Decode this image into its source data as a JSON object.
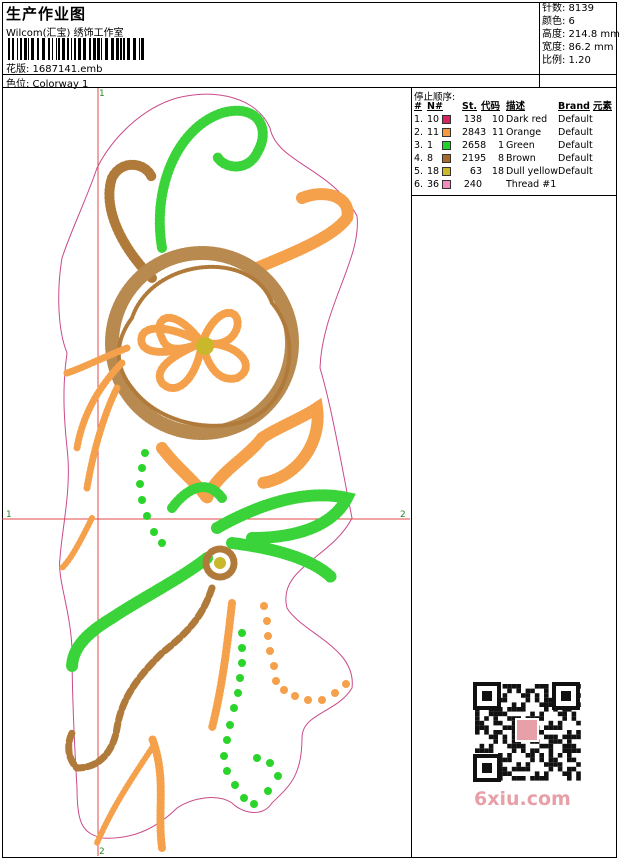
{
  "header": {
    "title": "生产作业图",
    "company": "Wilcom(汇宝) 绣饰工作室",
    "design_label": "花版: 1687141.emb",
    "colorway_label": "色位: Colorway 1"
  },
  "stats": {
    "stitches": "针数: 8139",
    "colors": "颜色: 6",
    "height": "高度: 214.8 mm",
    "width": "宽度: 86.2 mm",
    "scale": "比例: 1.20"
  },
  "sequence": {
    "heading": "停止顺序:",
    "columns": {
      "idx": "#",
      "n": "N#",
      "st": "St.",
      "code": "代码",
      "desc": "描述",
      "brand": "Brand",
      "elem": "元素"
    },
    "rows": [
      {
        "idx": "1.",
        "n": "10",
        "color": "#d6255b",
        "st": "138",
        "code": "10",
        "desc": "Dark red",
        "brand": "Default"
      },
      {
        "idx": "2.",
        "n": "11",
        "color": "#f39a3e",
        "st": "2843",
        "code": "11",
        "desc": "Orange",
        "brand": "Default"
      },
      {
        "idx": "3.",
        "n": "1",
        "color": "#21d12a",
        "st": "2658",
        "code": "1",
        "desc": "Green",
        "brand": "Default"
      },
      {
        "idx": "4.",
        "n": "8",
        "color": "#a86a2a",
        "st": "2195",
        "code": "8",
        "desc": "Brown",
        "brand": "Default"
      },
      {
        "idx": "5.",
        "n": "18",
        "color": "#c9b92a",
        "st": "63",
        "code": "18",
        "desc": "Dull yellow",
        "brand": "Default"
      },
      {
        "idx": "6.",
        "n": "36",
        "color": "#f28cbf",
        "st": "240",
        "code": "",
        "desc": "Thread #1",
        "brand": ""
      }
    ]
  },
  "axis": {
    "top": "1",
    "bottom": "2",
    "left": "1",
    "right": "2"
  },
  "watermark": "6xiu.com",
  "icons": {
    "barcode": "barcode-icon",
    "qr": "qr-code-icon"
  }
}
